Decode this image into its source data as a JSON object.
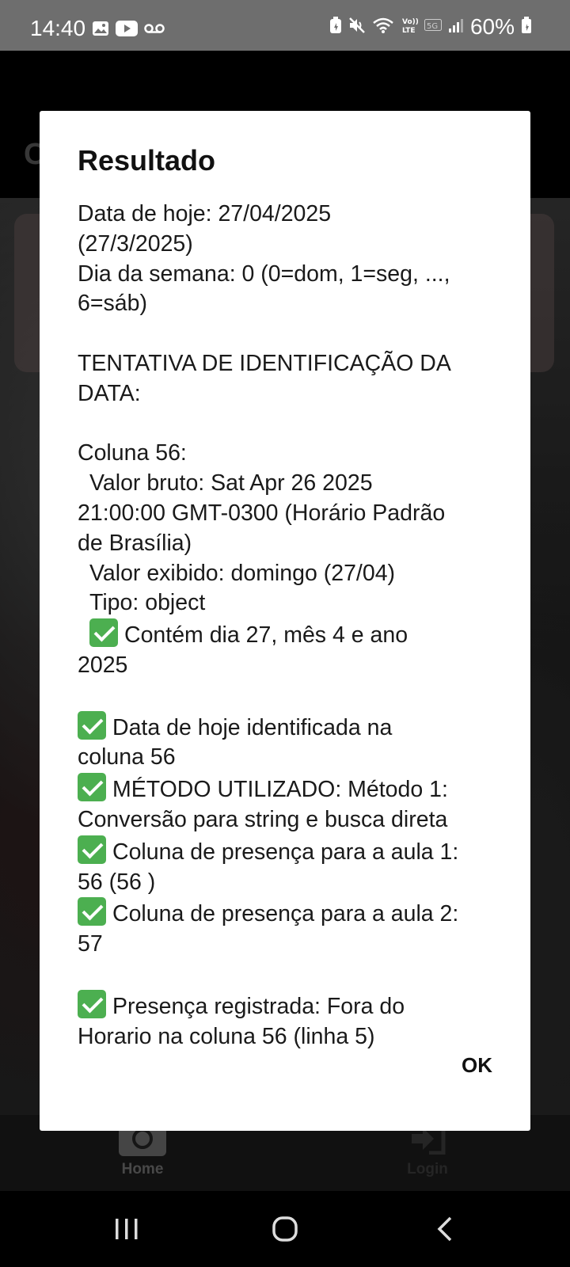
{
  "status_bar": {
    "time": "14:40",
    "battery": "60%",
    "icons": [
      "gallery-icon",
      "youtube-icon",
      "voicemail-icon",
      "battery-saver-icon",
      "mute-icon",
      "wifi-icon",
      "volte-icon",
      "5g-icon",
      "signal-icon",
      "battery-icon"
    ]
  },
  "background": {
    "header_letter": "C"
  },
  "dialog": {
    "title": "Resultado",
    "lines": [
      "Data de hoje: 27/04/2025",
      "(27/3/2025)",
      "Dia da semana: 0 (0=dom, 1=seg, ...,",
      "6=sáb)",
      "",
      "TENTATIVA DE IDENTIFICAÇÃO DA",
      "DATA:",
      "",
      "Coluna 56:",
      "Valor bruto: Sat Apr 26 2025",
      "21:00:00 GMT-0300 (Horário Padrão",
      "de Brasília)",
      "Valor exibido: domingo (27/04)",
      "Tipo: object",
      "Contém dia 27, mês 4 e ano",
      "2025",
      "",
      "Data de hoje identificada na",
      "coluna 56",
      "MÉTODO UTILIZADO: Método 1:",
      "Conversão para string e busca direta",
      "Coluna de presença para a aula 1:",
      "56 (56 )",
      "Coluna de presença para a aula 2:",
      "57",
      "",
      "Presença registrada: Fora do",
      "Horario na coluna 56 (linha 5)"
    ],
    "ok_label": "OK"
  },
  "bottom_nav": {
    "home_label": "Home",
    "login_label": "Login"
  },
  "colors": {
    "check_green": "#4caf50",
    "status_bar": "#6e6e6e"
  }
}
